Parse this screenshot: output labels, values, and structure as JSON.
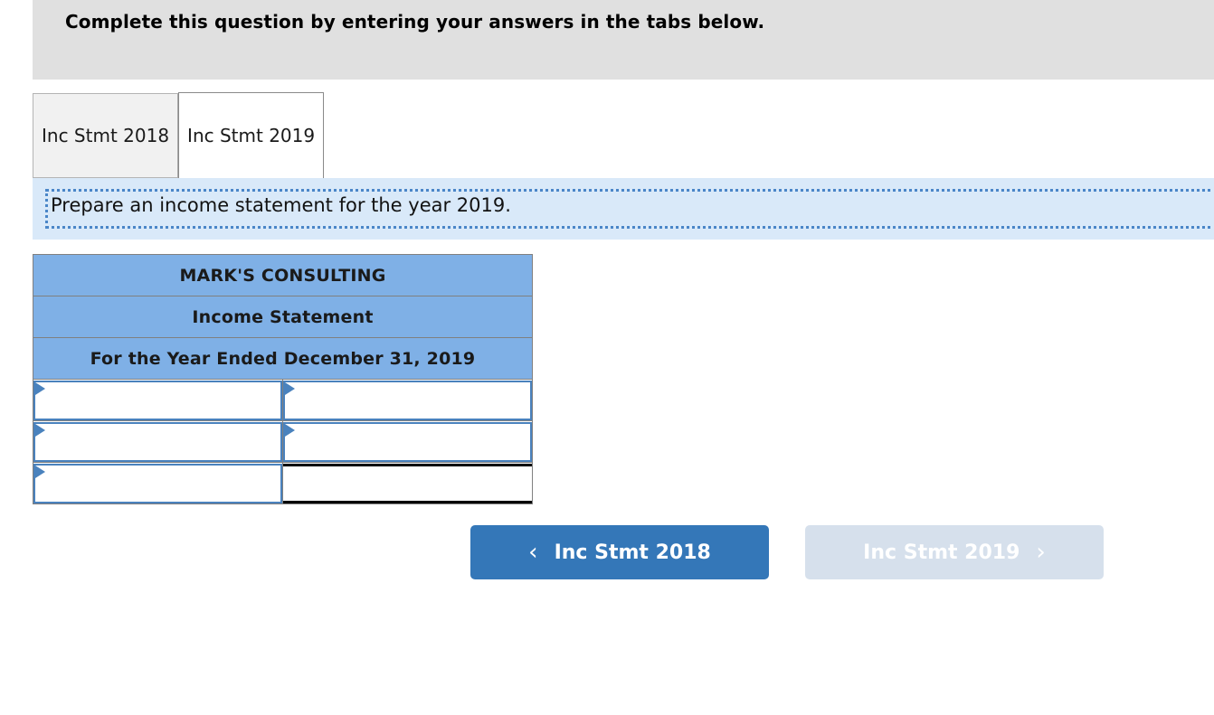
{
  "header": {
    "instruction": "Complete this question by entering your answers in the tabs below."
  },
  "tabs": [
    {
      "label": "Inc Stmt 2018",
      "active": false
    },
    {
      "label": "Inc Stmt 2019",
      "active": true
    }
  ],
  "panel": {
    "instruction": "Prepare an income statement for the year 2019."
  },
  "statement": {
    "title_lines": [
      "MARK'S CONSULTING",
      "Income Statement",
      "For the Year Ended December 31, 2019"
    ],
    "rows": [
      {
        "label_value": "",
        "amount_value": "",
        "style": "input"
      },
      {
        "label_value": "",
        "amount_value": "",
        "style": "input"
      },
      {
        "label_value": "",
        "amount_value": "",
        "style": "total"
      }
    ]
  },
  "nav": {
    "prev_label": "Inc Stmt 2018",
    "next_label": "Inc Stmt 2019",
    "prev_icon": "chevron-left-icon",
    "next_icon": "chevron-right-icon",
    "prev_chevron": "‹",
    "next_chevron": "›"
  },
  "colors": {
    "header_band": "#e0e0e0",
    "panel_blue": "#d9e9f9",
    "dotted_border": "#4a86c8",
    "table_header_blue": "#7fb0e6",
    "input_border": "#4a82bd",
    "btn_active": "#3477b8",
    "btn_disabled": "#d6e0ec"
  }
}
